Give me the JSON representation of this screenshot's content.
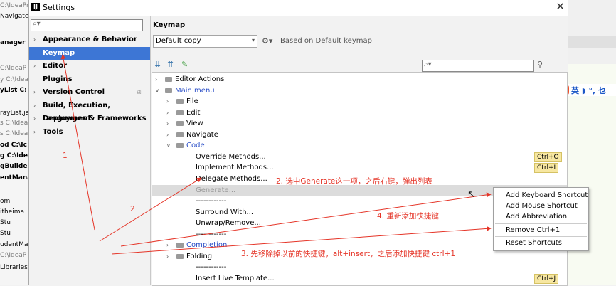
{
  "background": {
    "left_lines": [
      {
        "text": "C:\\IdeaPr",
        "style": "g"
      },
      {
        "text": "Navigate",
        "style": ""
      },
      {
        "text": "",
        "style": ""
      },
      {
        "text": "anager",
        "style": "b"
      },
      {
        "text": "",
        "style": ""
      },
      {
        "text": "C:\\IdeaP",
        "style": "g"
      },
      {
        "text": "y  C:\\Idea",
        "style": "g"
      },
      {
        "text": "yList  C:",
        "style": "b"
      },
      {
        "text": "",
        "style": ""
      },
      {
        "text": "rayList.ja",
        "style": ""
      },
      {
        "text": "s  C:\\Idea",
        "style": "g"
      },
      {
        "text": "s  C:\\Idea",
        "style": "g"
      },
      {
        "text": "od  C:\\Ic",
        "style": "b"
      },
      {
        "text": "g  C:\\Ide",
        "style": "b"
      },
      {
        "text": "gBuilder",
        "style": "b"
      },
      {
        "text": "entMana",
        "style": "b"
      },
      {
        "text": "",
        "style": ""
      },
      {
        "text": "om",
        "style": ""
      },
      {
        "text": "itheima",
        "style": ""
      },
      {
        "text": "Stu",
        "style": ""
      },
      {
        "text": "Stu",
        "style": ""
      },
      {
        "text": "udentMa",
        "style": ""
      },
      {
        "text": "C:\\IdeaP",
        "style": "g"
      },
      {
        "text": "Libraries",
        "style": ""
      }
    ],
    "ime": {
      "logo": "S",
      "text": "英 ◗ °, 乜"
    }
  },
  "window": {
    "icon": "IJ",
    "title": "Settings",
    "close": "✕"
  },
  "left": {
    "search_placeholder": "",
    "nav": [
      {
        "label": "Appearance & Behavior",
        "arrow": "›",
        "selected": false,
        "copy": ""
      },
      {
        "label": "Keymap",
        "arrow": "",
        "selected": true,
        "copy": ""
      },
      {
        "label": "Editor",
        "arrow": "›",
        "selected": false,
        "copy": ""
      },
      {
        "label": "Plugins",
        "arrow": "",
        "selected": false,
        "copy": ""
      },
      {
        "label": "Version Control",
        "arrow": "›",
        "selected": false,
        "copy": "⧉"
      },
      {
        "label": "Build, Execution, Deployment",
        "arrow": "›",
        "selected": false,
        "copy": ""
      },
      {
        "label": "Languages & Frameworks",
        "arrow": "›",
        "selected": false,
        "copy": ""
      },
      {
        "label": "Tools",
        "arrow": "›",
        "selected": false,
        "copy": ""
      }
    ]
  },
  "keymap": {
    "heading": "Keymap",
    "scheme": "Default copy",
    "based_on": "Based on Default keymap",
    "toolbar": [
      "expand-all-icon",
      "collapse-all-icon",
      "edit-icon"
    ],
    "tree": [
      {
        "level": 0,
        "exp": ">",
        "icon": true,
        "label": "Editor Actions",
        "blue": false,
        "shortcut": "",
        "gen": false
      },
      {
        "level": 0,
        "exp": "v",
        "icon": true,
        "label": "Main menu",
        "blue": true,
        "shortcut": "",
        "gen": false
      },
      {
        "level": 1,
        "exp": ">",
        "icon": true,
        "label": "File",
        "blue": false,
        "shortcut": "",
        "gen": false
      },
      {
        "level": 1,
        "exp": ">",
        "icon": true,
        "label": "Edit",
        "blue": false,
        "shortcut": "",
        "gen": false
      },
      {
        "level": 1,
        "exp": ">",
        "icon": true,
        "label": "View",
        "blue": false,
        "shortcut": "",
        "gen": false
      },
      {
        "level": 1,
        "exp": ">",
        "icon": true,
        "label": "Navigate",
        "blue": false,
        "shortcut": "",
        "gen": false
      },
      {
        "level": 1,
        "exp": "v",
        "icon": true,
        "label": "Code",
        "blue": true,
        "shortcut": "",
        "gen": false
      },
      {
        "level": 2,
        "exp": "",
        "icon": false,
        "label": "Override Methods...",
        "blue": false,
        "shortcut": "Ctrl+O",
        "gen": false
      },
      {
        "level": 2,
        "exp": "",
        "icon": false,
        "label": "Implement Methods...",
        "blue": false,
        "shortcut": "Ctrl+I",
        "gen": false
      },
      {
        "level": 2,
        "exp": "",
        "icon": false,
        "label": "Delegate Methods...",
        "blue": false,
        "shortcut": "",
        "gen": false
      },
      {
        "level": 2,
        "exp": "",
        "icon": false,
        "label": "Generate...",
        "blue": false,
        "shortcut": "",
        "gen": true
      },
      {
        "level": 2,
        "exp": "",
        "icon": false,
        "label": "------------",
        "blue": false,
        "shortcut": "",
        "gen": false
      },
      {
        "level": 2,
        "exp": "",
        "icon": false,
        "label": "Surround With...",
        "blue": false,
        "shortcut": "",
        "gen": false
      },
      {
        "level": 2,
        "exp": "",
        "icon": false,
        "label": "Unwrap/Remove...",
        "blue": false,
        "shortcut": "",
        "gen": false
      },
      {
        "level": 2,
        "exp": "",
        "icon": false,
        "label": "------------",
        "blue": false,
        "shortcut": "",
        "gen": false
      },
      {
        "level": 1,
        "exp": ">",
        "icon": true,
        "label": "Completion",
        "blue": true,
        "shortcut": "",
        "gen": false
      },
      {
        "level": 1,
        "exp": ">",
        "icon": true,
        "label": "Folding",
        "blue": false,
        "shortcut": "",
        "gen": false
      },
      {
        "level": 2,
        "exp": "",
        "icon": false,
        "label": "------------",
        "blue": false,
        "shortcut": "",
        "gen": false
      },
      {
        "level": 2,
        "exp": "",
        "icon": false,
        "label": "Insert Live Template...",
        "blue": false,
        "shortcut": "Ctrl+J",
        "gen": false
      }
    ]
  },
  "context_menu": {
    "items": [
      {
        "label": "Add Keyboard Shortcut",
        "sep_before": false
      },
      {
        "label": "Add Mouse Shortcut",
        "sep_before": false
      },
      {
        "label": "Add Abbreviation",
        "sep_before": false
      },
      {
        "label": "Remove Ctrl+1",
        "sep_before": true
      },
      {
        "label": "Reset Shortcuts",
        "sep_before": true
      }
    ]
  },
  "annotations": {
    "n1": "1",
    "n2": "2",
    "step2": "2. 选中Generate这一项，之后右键，弹出列表",
    "step4": "4. 重新添加快捷键",
    "step3": "3. 先移除掉以前的快捷键，alt+insert，之后添加快捷键 ctrl+1",
    "color": "#e53528"
  }
}
